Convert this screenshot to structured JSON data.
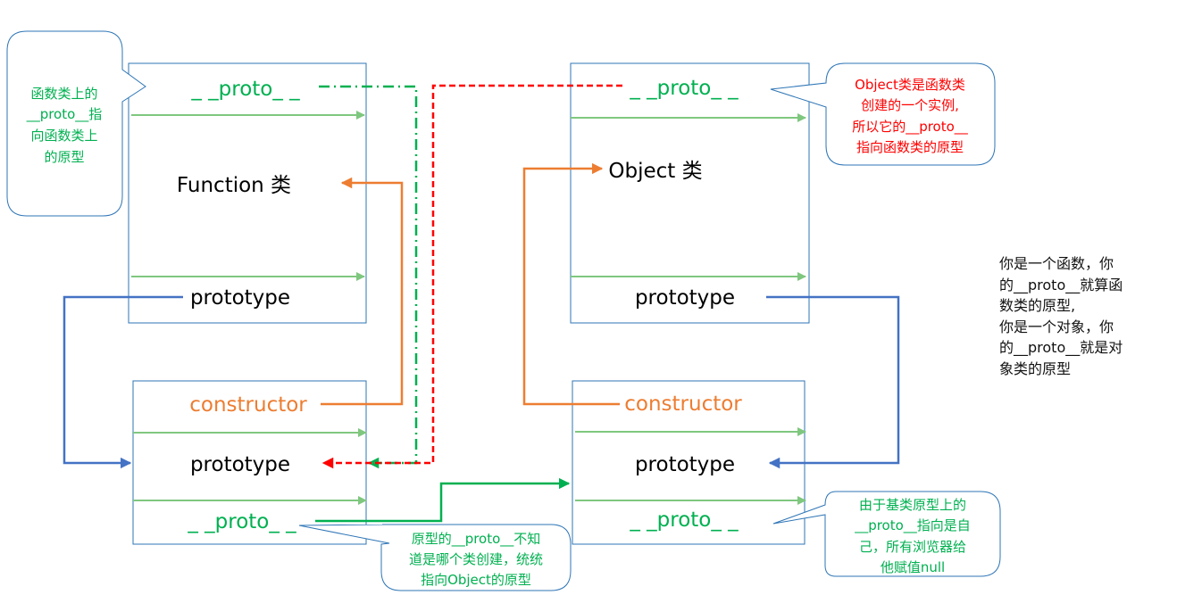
{
  "colors": {
    "box_border": "#2e75b6",
    "proto_green": "#00b050",
    "light_green": "#7fc77f",
    "orange": "#ed7d31",
    "blue": "#4472c4",
    "red": "#ff0000",
    "dark_green": "#00b050",
    "callout_border": "#2e75b6"
  },
  "function_class": {
    "proto_label": "_ _proto_ _",
    "title": "Function 类",
    "prototype_label": "prototype"
  },
  "object_class": {
    "proto_label": "_ _proto_ _",
    "title": "Object 类",
    "prototype_label": "prototype"
  },
  "function_prototype_obj": {
    "constructor_label": "constructor",
    "prototype_label": "prototype",
    "proto_label": "_ _proto_ _"
  },
  "object_prototype_obj": {
    "constructor_label": "constructor",
    "prototype_label": "prototype",
    "proto_label": "_ _proto_ _"
  },
  "callouts": {
    "function_proto": [
      "函数类上的",
      "__proto__指",
      "向函数类上",
      "的原型"
    ],
    "object_instance": [
      "Object类是函数类",
      "创建的一个实例,",
      "所以它的__proto__",
      "指向函数类的原型"
    ],
    "base_proto": [
      "由于基类原型上的",
      "__proto__指向是自",
      "己，所有浏览器给",
      "他赋值null"
    ],
    "prototype_proto": [
      "原型的__proto__不知",
      "道是哪个类创建，统统",
      "指向Object的原型"
    ]
  },
  "side_note": [
    "你是一个函数，你",
    "的__proto__就算函",
    "数类的原型,",
    "你是一个对象，你",
    "的__proto__就是对",
    "象类的原型"
  ]
}
